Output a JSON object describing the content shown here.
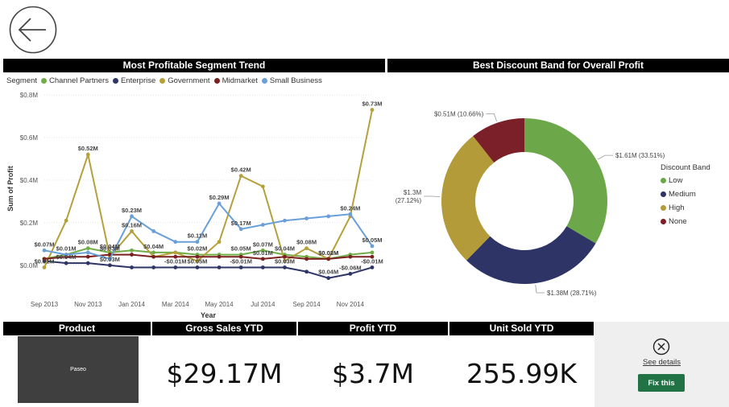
{
  "left_title": "Most Profitable Segment Trend",
  "right_title": "Best Discount Band for Overall Profit",
  "segment_legend": {
    "title": "Segment",
    "items": [
      {
        "label": "Channel Partners",
        "color": "#70ad47"
      },
      {
        "label": "Enterprise",
        "color": "#2e3466"
      },
      {
        "label": "Government",
        "color": "#b5a03a"
      },
      {
        "label": "Midmarket",
        "color": "#7b1f1f"
      },
      {
        "label": "Small Business",
        "color": "#6a9fd8"
      }
    ]
  },
  "donut_legend": {
    "title": "Discount Band",
    "items": [
      {
        "label": "Low",
        "color": "#6ca84a"
      },
      {
        "label": "Medium",
        "color": "#2e3466"
      },
      {
        "label": "High",
        "color": "#b39b3a"
      },
      {
        "label": "None",
        "color": "#7b1f28"
      }
    ]
  },
  "chart_data": [
    {
      "type": "line",
      "title": "Most Profitable Segment Trend",
      "xlabel": "Year",
      "ylabel": "Sum of Profit",
      "x": [
        "Sep 2013",
        "Oct 2013",
        "Nov 2013",
        "Dec 2013",
        "Jan 2014",
        "Feb 2014",
        "Mar 2014",
        "Apr 2014",
        "May 2014",
        "Jun 2014",
        "Jul 2014",
        "Aug 2014",
        "Sep 2014",
        "Oct 2014",
        "Nov 2014",
        "Dec 2014"
      ],
      "x_tick_labels": [
        "Sep 2013",
        "Nov 2013",
        "Jan 2014",
        "Mar 2014",
        "May 2014",
        "Jul 2014",
        "Sep 2014",
        "Nov 2014"
      ],
      "y_ticks": [
        "$0.0M",
        "$0.2M",
        "$0.4M",
        "$0.6M",
        "$0.8M"
      ],
      "ylim": [
        -0.08,
        0.8
      ],
      "series": [
        {
          "name": "Channel Partners",
          "color": "#70ad47",
          "values": [
            0.03,
            0.05,
            0.08,
            0.06,
            0.07,
            0.06,
            0.06,
            0.05,
            0.05,
            0.05,
            0.07,
            0.05,
            0.04,
            0.03,
            0.05,
            0.06
          ]
        },
        {
          "name": "Enterprise",
          "color": "#2e3466",
          "values": [
            0.02,
            0.01,
            0.01,
            0.0,
            -0.01,
            -0.01,
            -0.01,
            -0.01,
            -0.01,
            -0.01,
            -0.01,
            -0.01,
            -0.03,
            -0.06,
            -0.04,
            -0.01
          ]
        },
        {
          "name": "Government",
          "color": "#b5a03a",
          "values": [
            -0.01,
            0.21,
            0.52,
            0.04,
            0.16,
            0.04,
            0.06,
            0.02,
            0.11,
            0.42,
            0.37,
            0.02,
            0.08,
            0.03,
            0.23,
            0.73
          ]
        },
        {
          "name": "Midmarket",
          "color": "#7b1f1f",
          "values": [
            0.03,
            0.04,
            0.04,
            0.05,
            0.05,
            0.04,
            0.04,
            0.04,
            0.04,
            0.04,
            0.03,
            0.04,
            0.03,
            0.03,
            0.04,
            0.04
          ]
        },
        {
          "name": "Small Business",
          "color": "#6a9fd8",
          "values": [
            0.07,
            0.05,
            0.06,
            0.03,
            0.23,
            0.16,
            0.11,
            0.11,
            0.29,
            0.17,
            0.19,
            0.21,
            0.22,
            0.23,
            0.24,
            0.09
          ]
        }
      ],
      "data_labels": [
        {
          "series": 4,
          "i": 0,
          "text": "$0.07M"
        },
        {
          "series": 2,
          "i": 0,
          "text": "$0.01M"
        },
        {
          "series": 0,
          "i": 1,
          "text": "$0.01M"
        },
        {
          "series": 1,
          "i": 1,
          "text": "$0.04M"
        },
        {
          "series": 2,
          "i": 2,
          "text": "$0.52M"
        },
        {
          "series": 0,
          "i": 2,
          "text": "$0.08M"
        },
        {
          "series": 0,
          "i": 3,
          "text": "$0.04M"
        },
        {
          "series": 3,
          "i": 3,
          "text": "$0.03M"
        },
        {
          "series": 1,
          "i": 3,
          "text": "$0.03M"
        },
        {
          "series": 4,
          "i": 4,
          "text": "$0.23M"
        },
        {
          "series": 2,
          "i": 4,
          "text": "$0.16M"
        },
        {
          "series": 0,
          "i": 5,
          "text": "$0.04M"
        },
        {
          "series": 1,
          "i": 6,
          "text": "-$0.01M"
        },
        {
          "series": 4,
          "i": 7,
          "text": "$0.11M"
        },
        {
          "series": 0,
          "i": 7,
          "text": "$0.02M"
        },
        {
          "series": 1,
          "i": 7,
          "text": "$0.05M"
        },
        {
          "series": 4,
          "i": 8,
          "text": "$0.29M"
        },
        {
          "series": 1,
          "i": 9,
          "text": "-$0.01M"
        },
        {
          "series": 2,
          "i": 9,
          "text": "$0.42M"
        },
        {
          "series": 4,
          "i": 9,
          "text": "$0.17M"
        },
        {
          "series": 0,
          "i": 9,
          "text": "$0.05M"
        },
        {
          "series": 0,
          "i": 10,
          "text": "$0.07M"
        },
        {
          "series": 3,
          "i": 10,
          "text": "$0.01M"
        },
        {
          "series": 1,
          "i": 11,
          "text": "$0.03M"
        },
        {
          "series": 0,
          "i": 11,
          "text": "$0.04M"
        },
        {
          "series": 2,
          "i": 12,
          "text": "$0.08M"
        },
        {
          "series": 0,
          "i": 13,
          "text": "$0.03M"
        },
        {
          "series": 3,
          "i": 13,
          "text": "$0.02M"
        },
        {
          "series": 1,
          "i": 13,
          "text": "$0.04M"
        },
        {
          "series": 4,
          "i": 14,
          "text": "$0.24M"
        },
        {
          "series": 1,
          "i": 14,
          "text": "-$0.06M"
        },
        {
          "series": 2,
          "i": 15,
          "text": "$0.73M"
        },
        {
          "series": 4,
          "i": 15,
          "text": "$0.05M"
        },
        {
          "series": 1,
          "i": 15,
          "text": "-$0.01M"
        }
      ]
    },
    {
      "type": "pie",
      "title": "Best Discount Band for Overall Profit",
      "donut": true,
      "categories": [
        "Low",
        "Medium",
        "High",
        "None"
      ],
      "values": [
        1.61,
        1.38,
        1.3,
        0.51
      ],
      "percent": [
        33.51,
        28.71,
        27.12,
        10.66
      ],
      "labels": [
        "$1.61M (33.51%)",
        "$1.38M (28.71%)",
        "$1.3M (27.12%)",
        "$0.51M (10.66%)"
      ],
      "colors": [
        "#6ca84a",
        "#2e3466",
        "#b39b3a",
        "#7b1f28"
      ]
    }
  ],
  "kpis": {
    "product_header": "Product",
    "product_value": "Paseo",
    "gross_header": "Gross Sales YTD",
    "gross_value": "$29.17M",
    "profit_header": "Profit YTD",
    "profit_value": "$3.7M",
    "units_header": "Unit Sold YTD",
    "units_value": "255.99K"
  },
  "side_panel": {
    "see_details": "See details",
    "fix_label": "Fix this"
  }
}
